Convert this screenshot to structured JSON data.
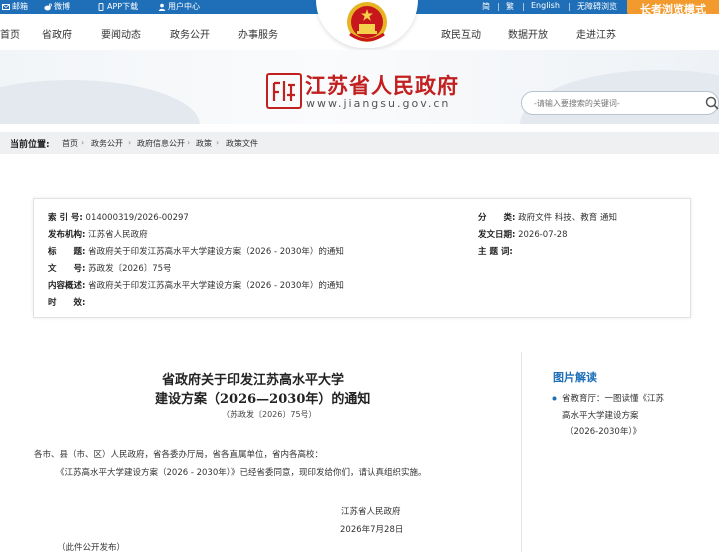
{
  "topbar": {
    "mail_label": "邮箱",
    "weibo_label": "微博",
    "app_label": "APP下载",
    "user_label": "用户中心",
    "simplified_label": "简",
    "traditional_label": "繁",
    "english_label": "English",
    "accessibility_label": "无障碍浏览",
    "elder_mode_label": "长者浏览模式"
  },
  "nav": {
    "home": "首页",
    "government": "省政府",
    "news": "要闻动态",
    "openness": "政务公开",
    "services": "办事服务",
    "interaction": "政民互动",
    "data": "数据开放",
    "about": "走进江苏"
  },
  "banner": {
    "site_title": "江苏省人民政府",
    "site_url": "www.jiangsu.gov.cn",
    "search_placeholder": "-请输入要搜索的关键词-"
  },
  "breadcrumb": {
    "label": "当前位置:",
    "items": [
      "首页",
      "政务公开",
      "政府信息公开",
      "政策",
      "政策文件"
    ]
  },
  "info": {
    "index_key": "索 引 号:",
    "index_val": "014000319/2026-00297",
    "org_key": "发布机构:",
    "org_val": "江苏省人民政府",
    "title_key": "标　　题:",
    "title_val": "省政府关于印发江苏高水平大学建设方案（2026 - 2030年）的通知",
    "docno_key": "文　　号:",
    "docno_val": "苏政发〔2026〕75号",
    "summary_key": "内容概述:",
    "summary_val": "省政府关于印发江苏高水平大学建设方案（2026 - 2030年）的通知",
    "validity_key": "时　　效:",
    "validity_val": "",
    "category_key": "分　　类:",
    "category_val": "政府文件 科技、教育 通知",
    "date_key": "发文日期:",
    "date_val": "2026-07-28",
    "subject_key": "主 题 词:",
    "subject_val": ""
  },
  "article": {
    "title_line1": "省政府关于印发江苏高水平大学",
    "title_line2": "建设方案（2026—2030年）的通知",
    "doc_number": "（苏政发〔2026〕75号）",
    "salutation": "各市、县（市、区）人民政府，省各委办厅局，省各直属单位，省内各高校：",
    "body": "《江苏高水平大学建设方案（2026 - 2030年）》已经省委同意，现印发给你们，请认真组织实施。",
    "signature": "江苏省人民政府",
    "date": "2026年7月28日",
    "note": "（此件公开发布）"
  },
  "sidebar": {
    "heading": "图片解读",
    "item_line1": "省教育厅：一图读懂《江苏",
    "item_line2": "高水平大学建设方案",
    "item_line3": "（2026-2030年）》"
  },
  "colors": {
    "topbar": "#1f6fb8",
    "brand_red": "#c21f1f",
    "elder_orange": "#f29a2e",
    "sidebar_blue": "#1f6fb8"
  }
}
